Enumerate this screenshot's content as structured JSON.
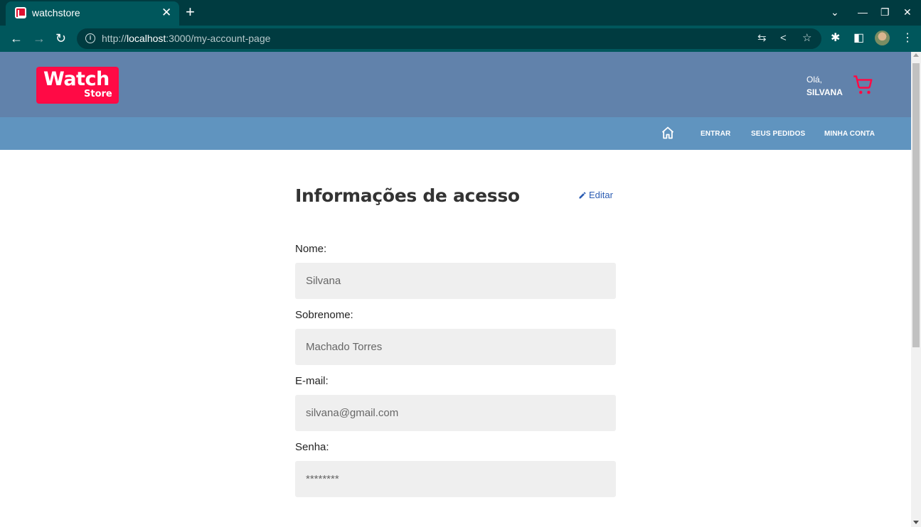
{
  "browser": {
    "tab_title": "watchstore",
    "tab_close": "✕",
    "new_tab": "+",
    "url_scheme": "http://",
    "url_host": "localhost",
    "url_rest": ":3000/my-account-page",
    "window": {
      "minimize": "—",
      "maximize": "❐",
      "close": "✕"
    }
  },
  "header": {
    "logo_top": "Watch",
    "logo_bottom": "Store",
    "greeting": "Olá,",
    "user_name": "SILVANA"
  },
  "nav": {
    "links": [
      "ENTRAR",
      "SEUS PEDIDOS",
      "MINHA CONTA"
    ]
  },
  "account": {
    "title": "Informações de acesso",
    "edit_label": "Editar",
    "fields": [
      {
        "label": "Nome:",
        "value": "Silvana"
      },
      {
        "label": "Sobrenome:",
        "value": "Machado Torres"
      },
      {
        "label": "E-mail:",
        "value": "silvana@gmail.com"
      },
      {
        "label": "Senha:",
        "value": "********"
      }
    ]
  },
  "colors": {
    "header_bg": "#6182ab",
    "nav_bg": "#6094bf",
    "brand": "#ff0a45",
    "link": "#2b5cb3"
  }
}
